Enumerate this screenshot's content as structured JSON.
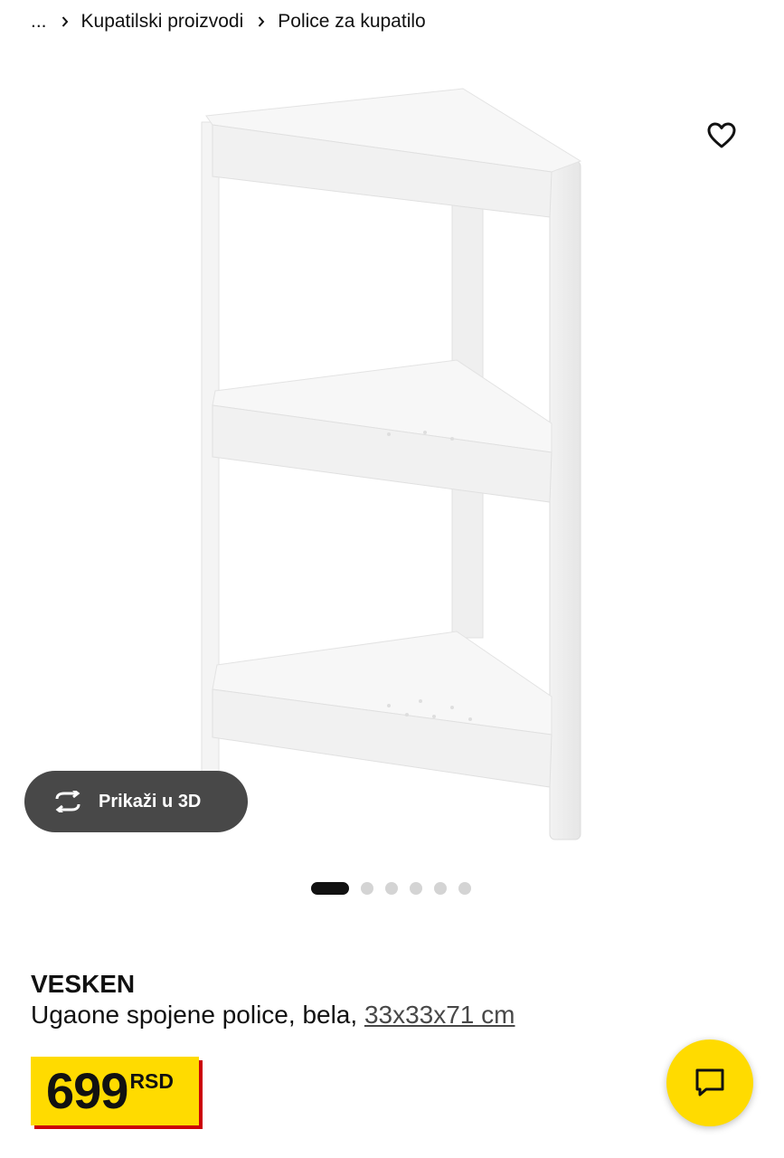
{
  "breadcrumb": {
    "ellipsis": "...",
    "items": [
      "Kupatilski proizvodi",
      "Police za kupatilo"
    ]
  },
  "gallery": {
    "view3d_label": "Prikaži u 3D",
    "slide_count": 6,
    "active_slide": 1
  },
  "product": {
    "name": "VESKEN",
    "description": "Ugaone spojene police, bela,",
    "dimensions": "33x33x71 cm",
    "price": "699",
    "currency": "RSD"
  },
  "colors": {
    "price_bg": "#ffdb00",
    "price_shadow": "#cc0008",
    "button_3d_bg": "#484848",
    "chat_bg": "#ffdb00"
  },
  "icons": [
    "chevron-right-icon",
    "heart-icon",
    "rotate-3d-icon",
    "chat-icon"
  ]
}
